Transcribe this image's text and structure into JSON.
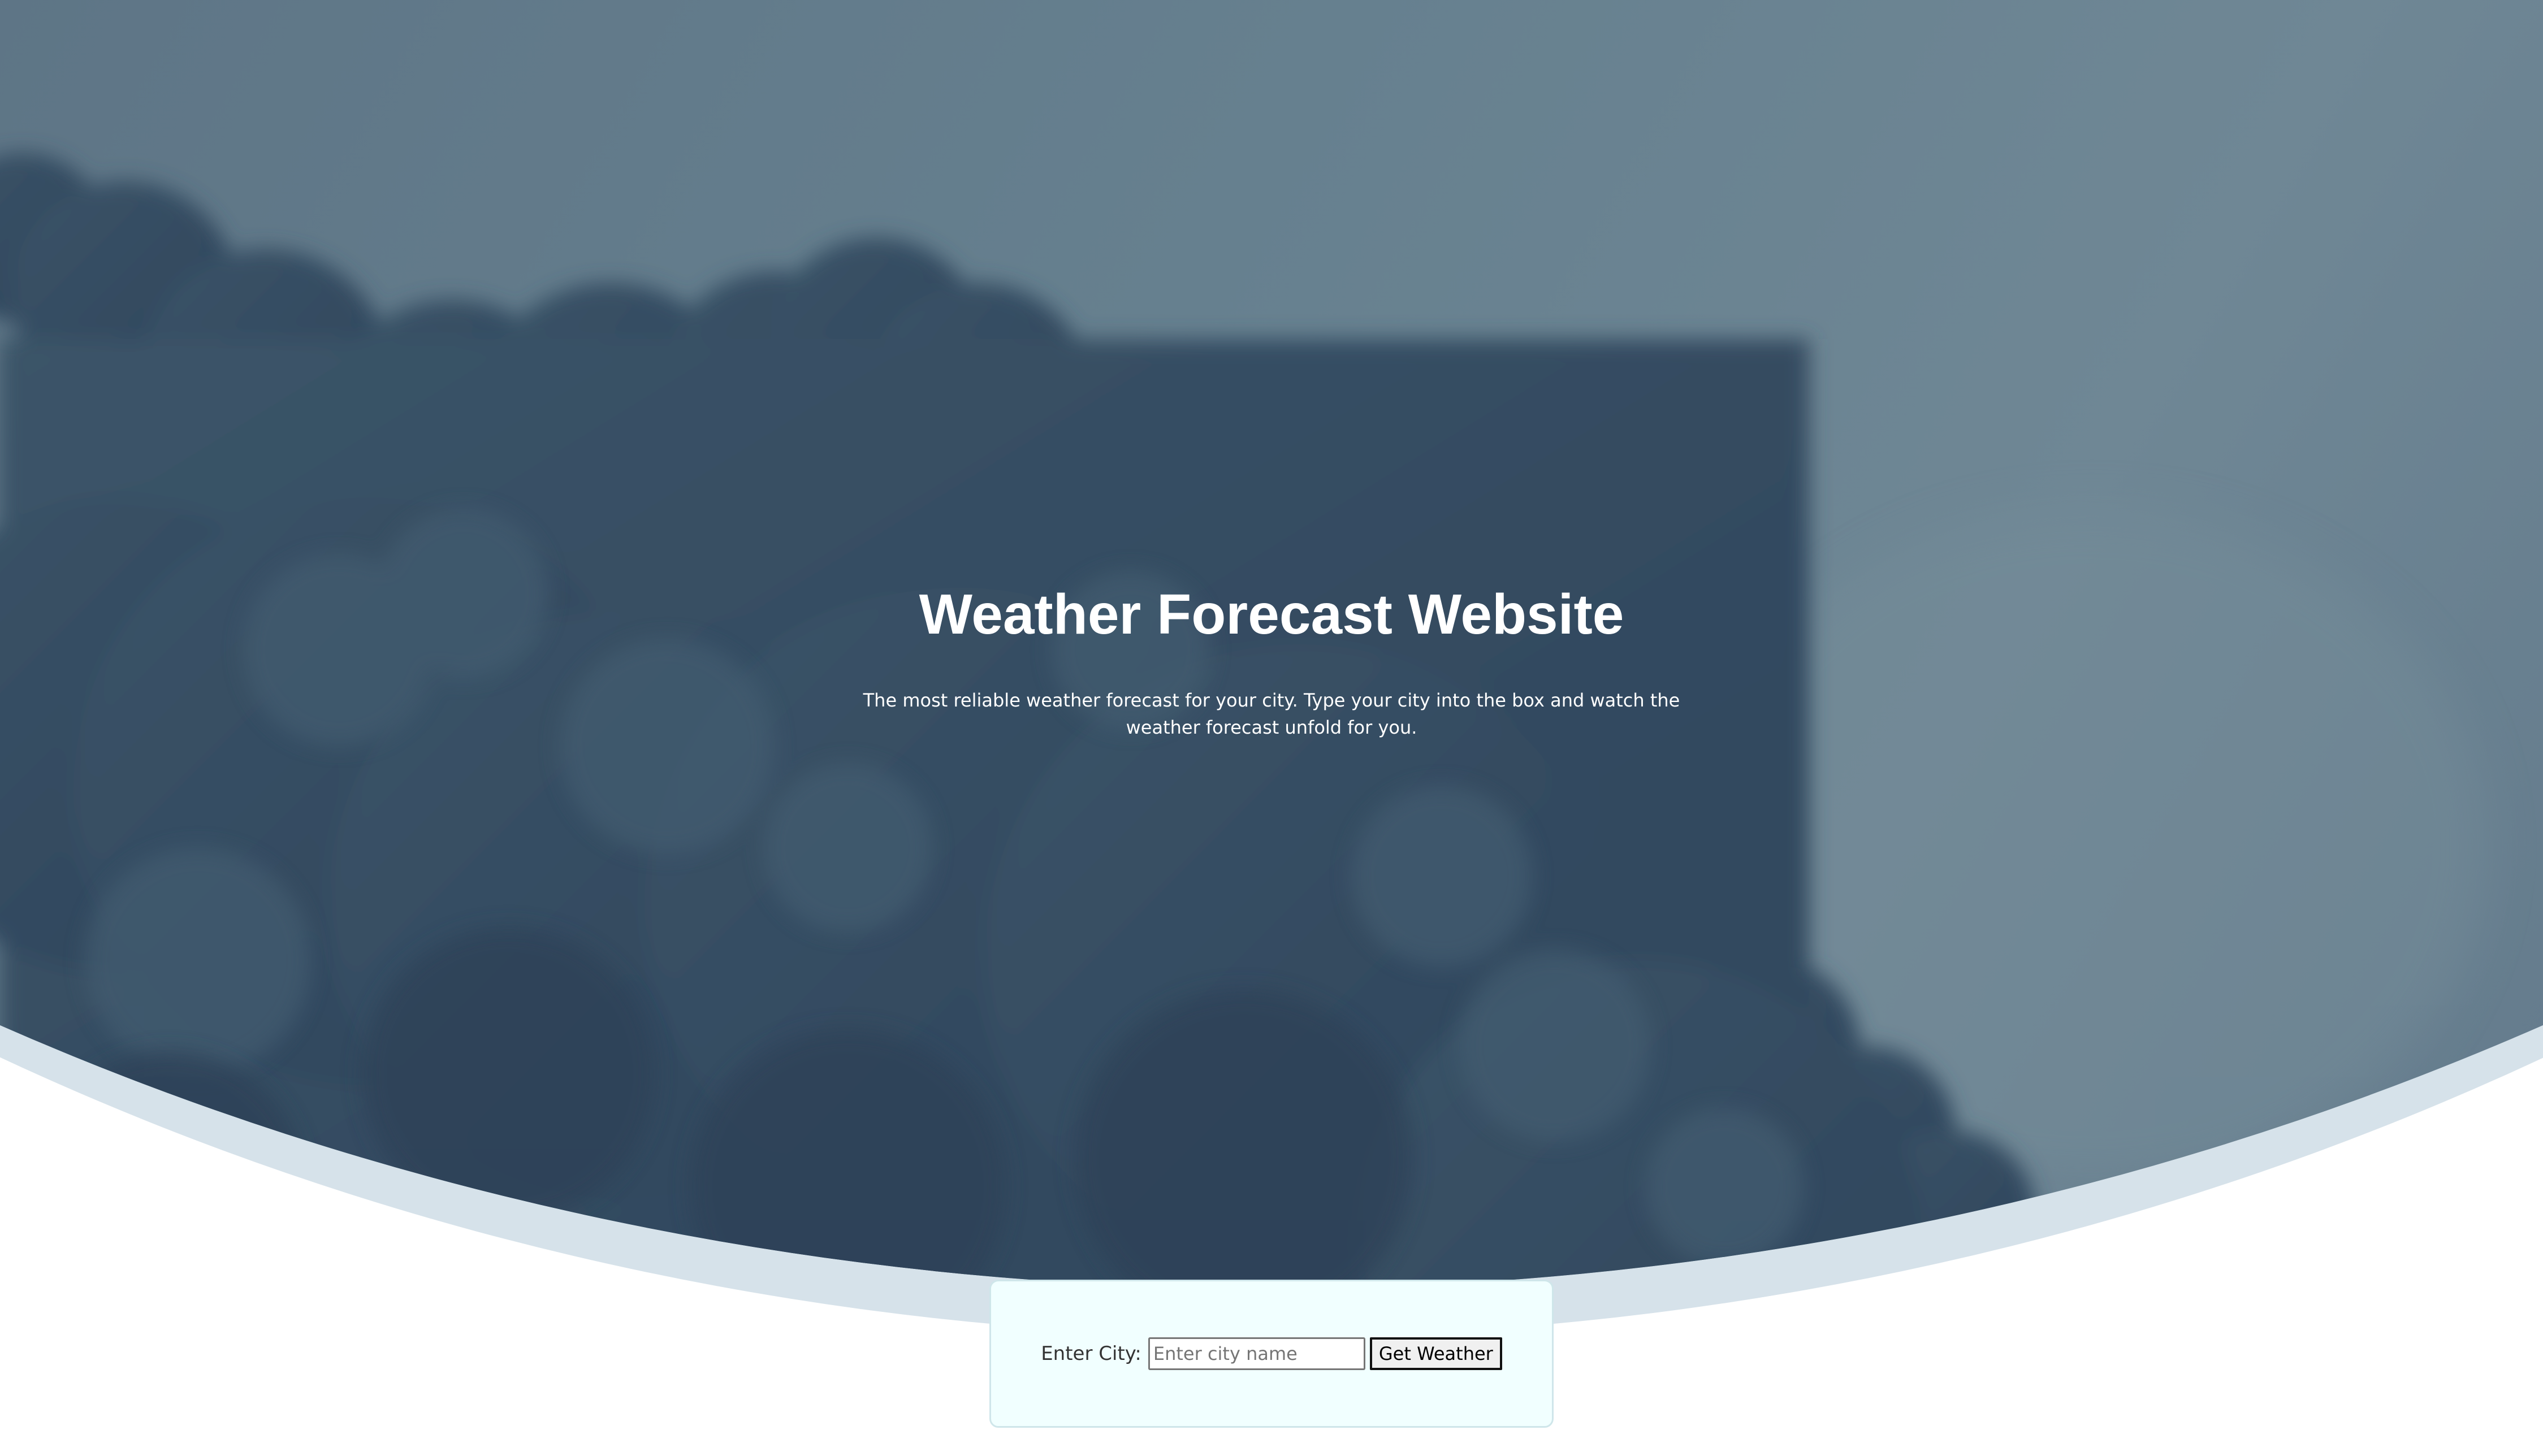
{
  "hero": {
    "title": "Weather Forecast Website",
    "subtitle": "The most reliable weather forecast for your city. Type your city into the box and watch the weather forecast unfold for you."
  },
  "search": {
    "label": "Enter City:",
    "placeholder": "Enter city name",
    "value": "",
    "button_label": "Get Weather"
  },
  "colors": {
    "sky": "#66808f",
    "cloud_dark": "#33495e",
    "swoosh": "#d6e2ea",
    "card_bg": "#f1ffff",
    "text_light": "#ffffff"
  }
}
